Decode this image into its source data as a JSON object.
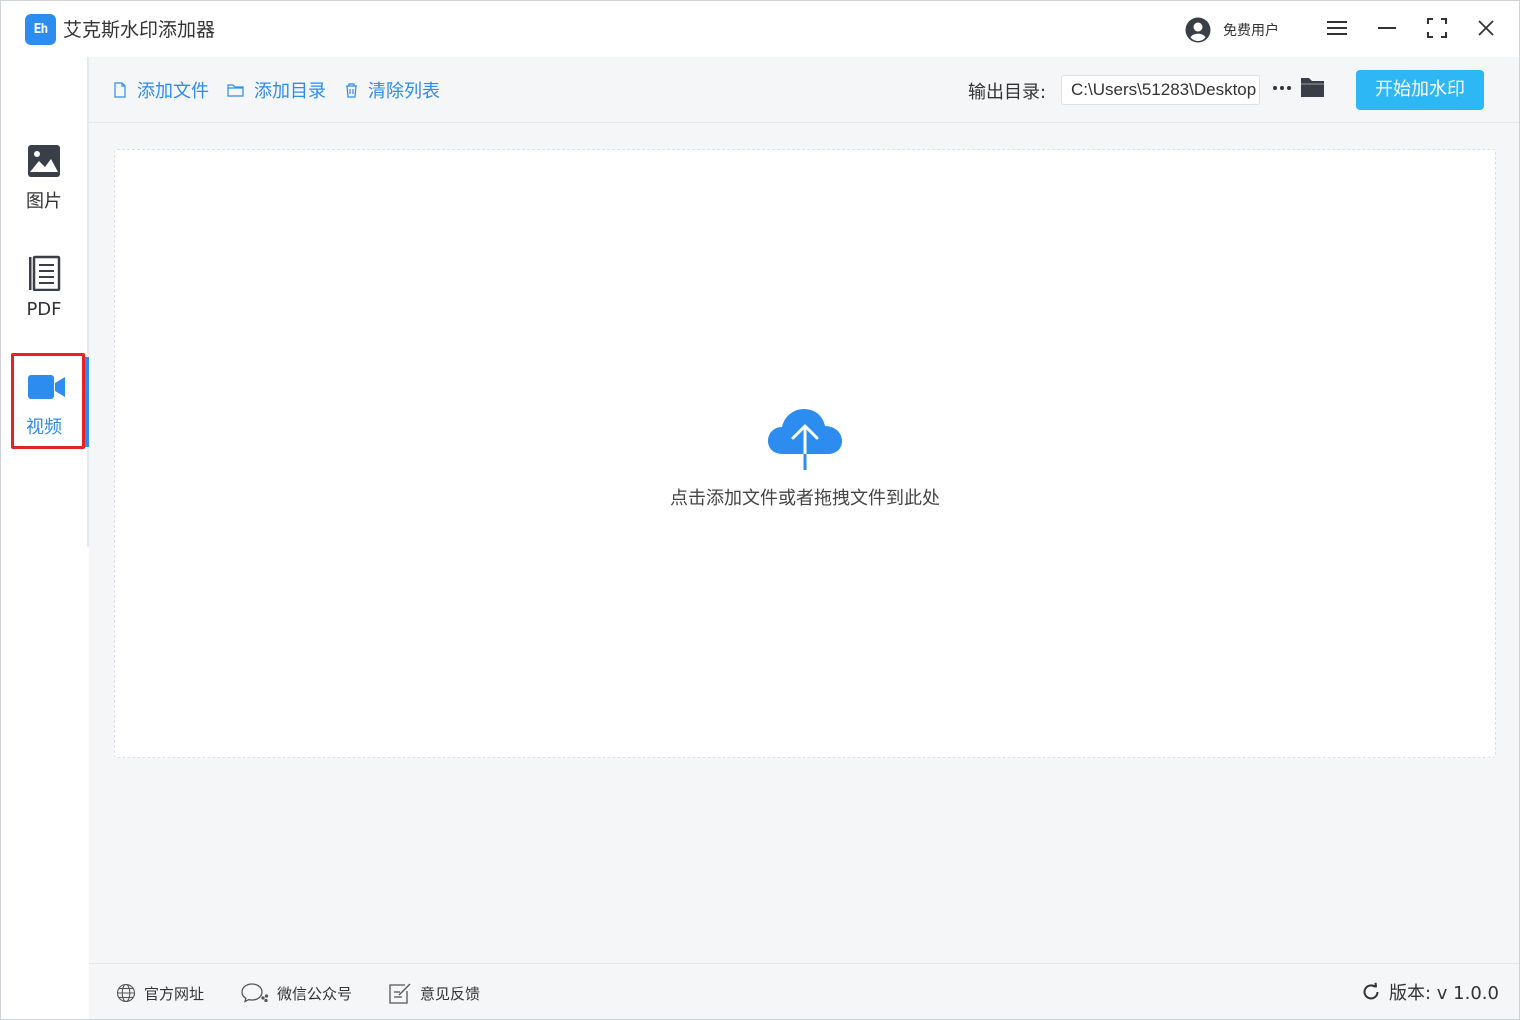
{
  "app": {
    "title": "艾克斯水印添加器",
    "logo_text": "Eh"
  },
  "titlebar": {
    "user_label": "免费用户",
    "icons": [
      "user-avatar-icon",
      "menu-icon",
      "minimize-icon",
      "maximize-icon",
      "close-icon"
    ]
  },
  "sidebar": {
    "items": [
      {
        "label": "图片",
        "icon": "image-icon",
        "active": false
      },
      {
        "label": "PDF",
        "icon": "pdf-document-icon",
        "active": false
      },
      {
        "label": "视频",
        "icon": "video-camera-icon",
        "active": true
      }
    ],
    "highlighted_item": "视频"
  },
  "toolbar": {
    "add_file": "添加文件",
    "add_dir": "添加目录",
    "clear_list": "清除列表",
    "output_label": "输出目录:",
    "output_path": "C:\\Users\\51283\\Desktop",
    "start_button": "开始加水印"
  },
  "dropzone": {
    "hint": "点击添加文件或者拖拽文件到此处",
    "icon": "cloud-upload-icon"
  },
  "footer": {
    "site": "官方网址",
    "wechat": "微信公众号",
    "feedback": "意见反馈",
    "version": "版本: v 1.0.0"
  },
  "colors": {
    "accent": "#2d8cf0",
    "start_button": "#2db7f5",
    "highlight_border": "#e62222",
    "main_bg": "#f4f6f8"
  }
}
